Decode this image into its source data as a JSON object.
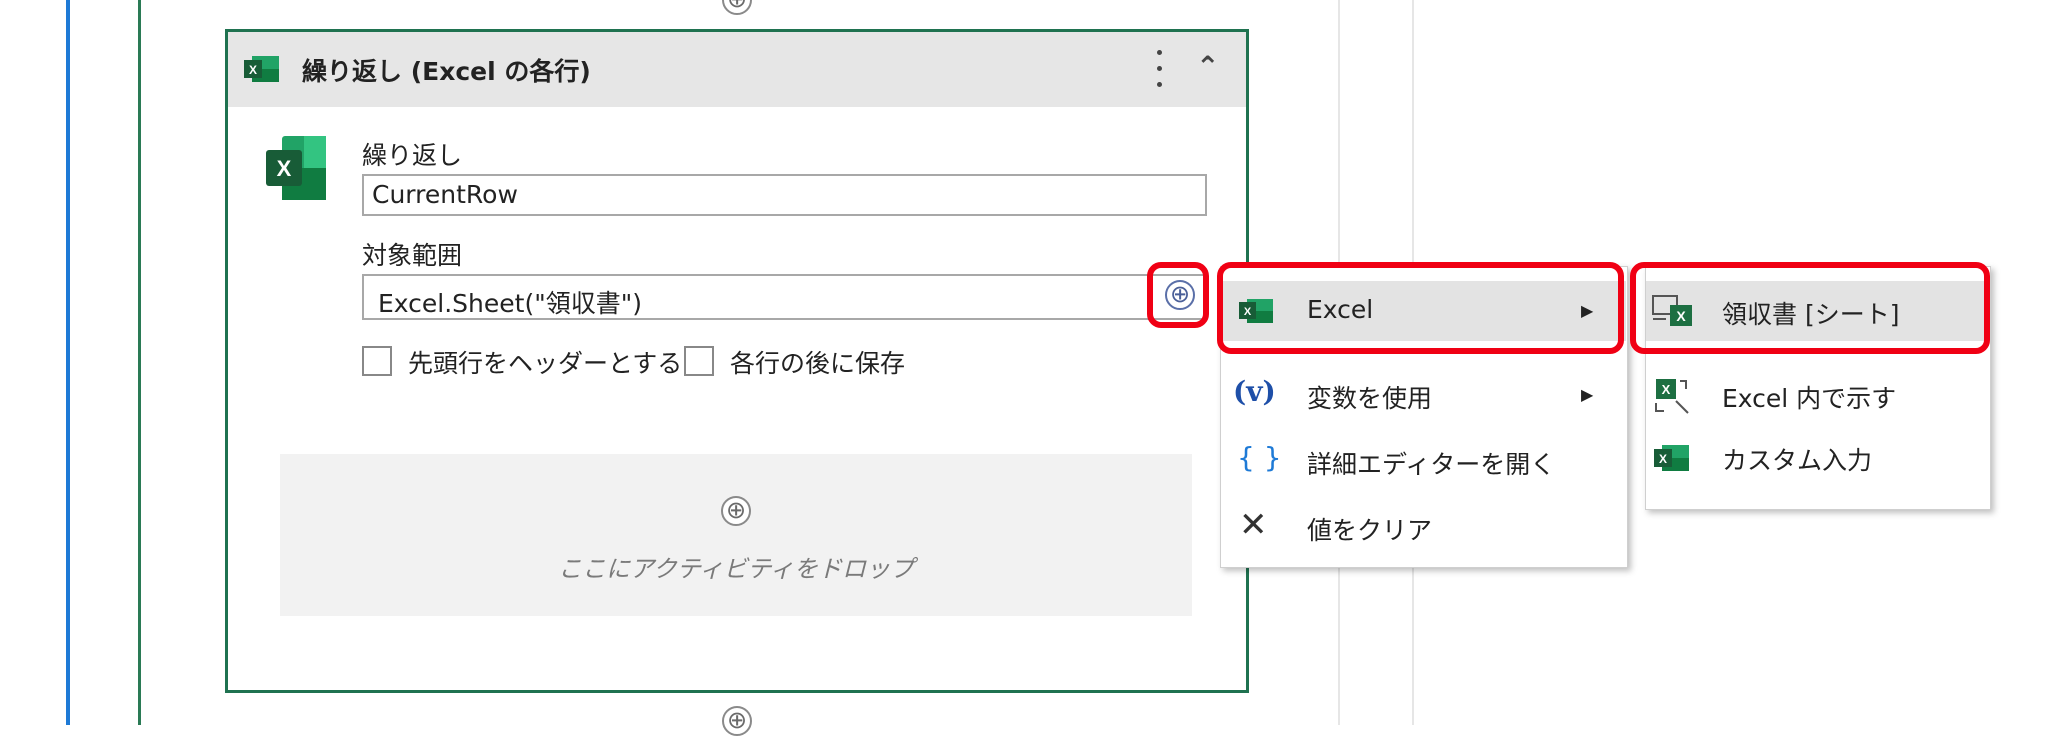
{
  "colors": {
    "accent_blue": "#1e7ad6",
    "card_border": "#1f7250",
    "excel_green": "#1d6f42",
    "highlight_red": "#f00014"
  },
  "add_icon": "⊕",
  "activity": {
    "title": "繰り返し (Excel の各行)",
    "icon": "excel-icon",
    "loop_label": "繰り返し",
    "loop_value": "CurrentRow",
    "range_label": "対象範囲",
    "range_value": "Excel.Sheet(\"領収書\")",
    "checkbox_header_label": "先頭行をヘッダーとする",
    "checkbox_save_label": "各行の後に保存",
    "dropzone_text": "ここにアクティビティをドロップ"
  },
  "menu": {
    "items": [
      {
        "label": "Excel",
        "icon": "excel-icon",
        "has_submenu": true,
        "highlighted": true
      },
      {
        "label": "変数を使用",
        "icon": "variable-icon",
        "icon_text": "(v)",
        "has_submenu": true
      },
      {
        "label": "詳細エディターを開く",
        "icon": "braces-icon",
        "icon_text": "{ }"
      },
      {
        "label": "値をクリア",
        "icon": "clear-icon",
        "icon_text": "✕"
      }
    ]
  },
  "submenu": {
    "items": [
      {
        "label": "領収書 [シート]",
        "icon": "sheet-icon",
        "highlighted": true
      },
      {
        "label": "Excel 内で示す",
        "icon": "excel-pick-icon"
      },
      {
        "label": "カスタム入力",
        "icon": "excel-icon"
      }
    ]
  }
}
